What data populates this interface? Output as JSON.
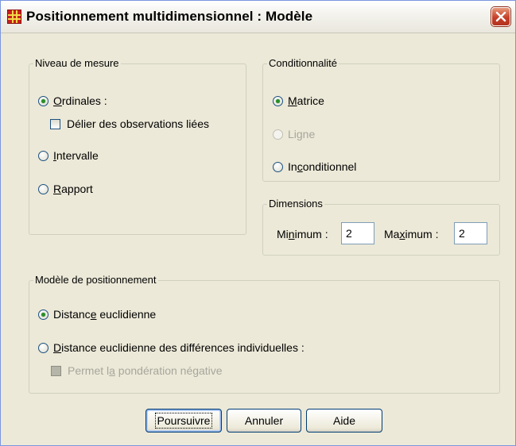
{
  "window": {
    "title": "Positionnement multidimensionnel : Modèle",
    "icon": "spss-grid-icon",
    "close_icon": "close-x-icon",
    "accent": "#c5402a"
  },
  "measure": {
    "legend": "Niveau de mesure",
    "ordinal": {
      "pre": "",
      "acc": "O",
      "post": "rdinales :",
      "checked": true
    },
    "untie": {
      "label": "Délier des observations liées",
      "checked": false
    },
    "interval": {
      "pre": "",
      "acc": "I",
      "post": "ntervalle",
      "checked": false
    },
    "ratio": {
      "pre": "",
      "acc": "R",
      "post": "apport",
      "checked": false
    }
  },
  "conditionality": {
    "legend": "Conditionnalité",
    "matrix": {
      "pre": "",
      "acc": "M",
      "post": "atrice",
      "checked": true
    },
    "row": {
      "label": "Ligne",
      "enabled": false
    },
    "unconditional": {
      "pre": "In",
      "acc": "c",
      "post": "onditionnel",
      "checked": false
    }
  },
  "dimensions": {
    "legend": "Dimensions",
    "min_label": {
      "pre": "Mi",
      "acc": "n",
      "post": "imum :"
    },
    "min_value": "2",
    "max_label": {
      "pre": "Ma",
      "acc": "x",
      "post": "imum :"
    },
    "max_value": "2"
  },
  "model": {
    "legend": "Modèle de positionnement",
    "euclidean": {
      "pre": "Distanc",
      "acc": "e",
      "post": " euclidienne",
      "checked": true
    },
    "indscal": {
      "pre": "",
      "acc": "D",
      "post": "istance euclidienne des différences individuelles :",
      "checked": false
    },
    "negative": {
      "pre": "Permet l",
      "acc": "a",
      "post": " pondération négative",
      "enabled": false
    }
  },
  "buttons": {
    "continue": "Poursuivre",
    "cancel": "Annuler",
    "help": "Aide"
  },
  "colors": {
    "dialog_bg": "#ece9d8",
    "radio_checked": "#2a8f2a",
    "button_border": "#003c74"
  }
}
